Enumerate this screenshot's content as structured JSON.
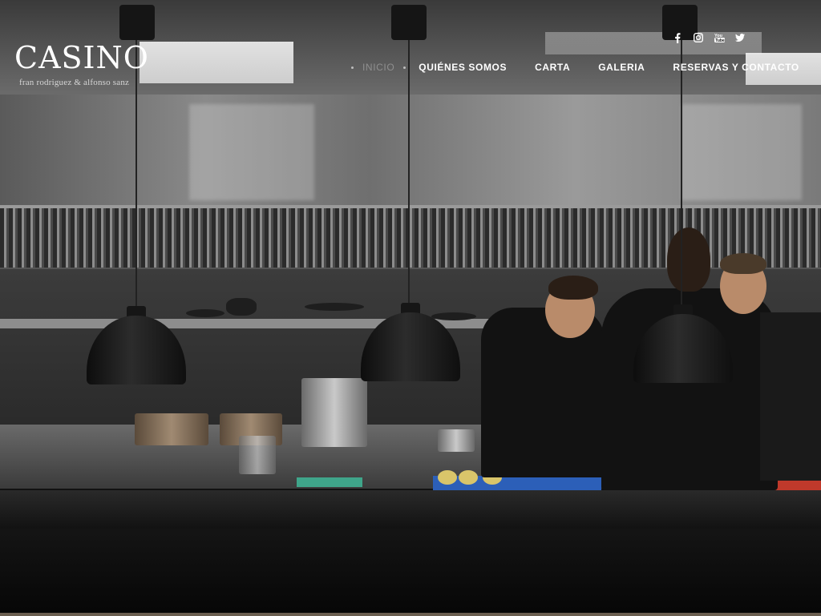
{
  "brand": {
    "logo_text": "CASINO",
    "tagline": "fran rodriguez & alfonso sanz"
  },
  "nav": {
    "items": [
      {
        "label": "INICIO",
        "active": true
      },
      {
        "label": "QUIÉNES SOMOS",
        "active": false
      },
      {
        "label": "CARTA",
        "active": false
      },
      {
        "label": "GALERIA",
        "active": false
      },
      {
        "label": "RESERVAS Y CONTACTO",
        "active": false
      }
    ],
    "active_color": "#8f8f8f",
    "text_color": "#ffffff"
  },
  "social": {
    "icons": [
      "facebook-icon",
      "instagram-icon",
      "youtube-icon",
      "twitter-icon"
    ]
  },
  "hero": {
    "image": "kitchen-with-chefs-and-pendant-lamps"
  }
}
